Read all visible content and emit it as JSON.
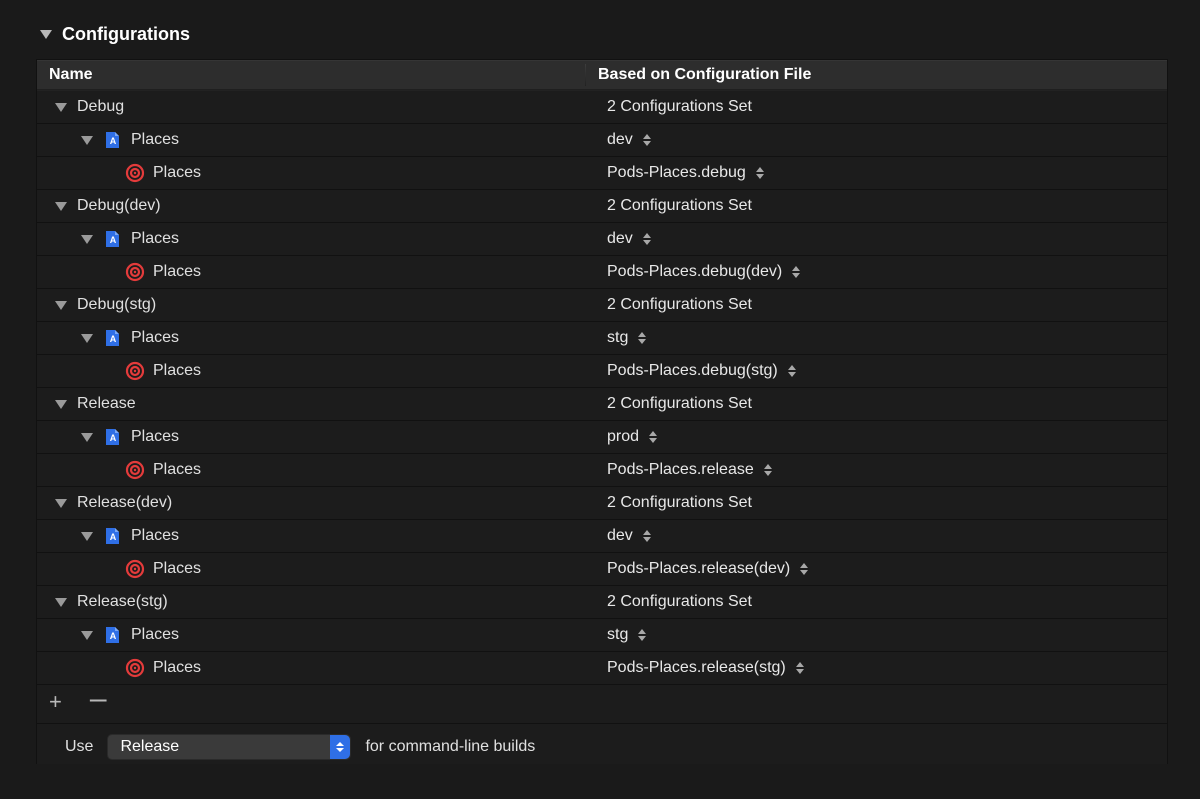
{
  "section": {
    "title": "Configurations"
  },
  "columns": {
    "name": "Name",
    "based": "Based on Configuration File"
  },
  "configs": [
    {
      "name": "Debug",
      "summary": "2 Configurations Set",
      "project": {
        "name": "Places",
        "value": "dev"
      },
      "target": {
        "name": "Places",
        "value": "Pods-Places.debug"
      }
    },
    {
      "name": "Debug(dev)",
      "summary": "2 Configurations Set",
      "project": {
        "name": "Places",
        "value": "dev"
      },
      "target": {
        "name": "Places",
        "value": "Pods-Places.debug(dev)"
      }
    },
    {
      "name": "Debug(stg)",
      "summary": "2 Configurations Set",
      "project": {
        "name": "Places",
        "value": "stg"
      },
      "target": {
        "name": "Places",
        "value": "Pods-Places.debug(stg)"
      }
    },
    {
      "name": "Release",
      "summary": "2 Configurations Set",
      "project": {
        "name": "Places",
        "value": "prod"
      },
      "target": {
        "name": "Places",
        "value": "Pods-Places.release"
      }
    },
    {
      "name": "Release(dev)",
      "summary": "2 Configurations Set",
      "project": {
        "name": "Places",
        "value": "dev"
      },
      "target": {
        "name": "Places",
        "value": "Pods-Places.release(dev)"
      }
    },
    {
      "name": "Release(stg)",
      "summary": "2 Configurations Set",
      "project": {
        "name": "Places",
        "value": "stg"
      },
      "target": {
        "name": "Places",
        "value": "Pods-Places.release(stg)"
      }
    }
  ],
  "use": {
    "prefix": "Use",
    "value": "Release",
    "suffix": "for command-line builds"
  }
}
